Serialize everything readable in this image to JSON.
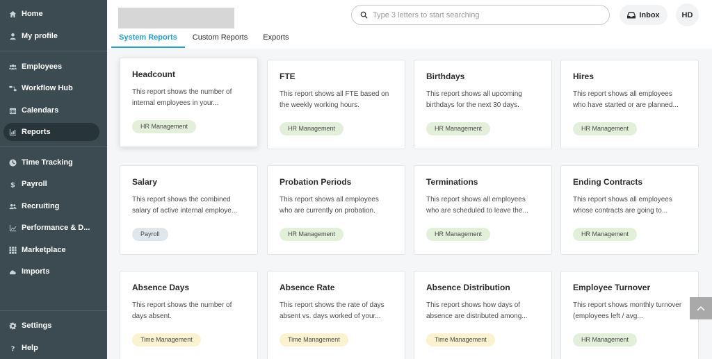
{
  "sidebar": {
    "items": [
      {
        "label": "Home",
        "icon": "home-icon",
        "active": false
      },
      {
        "label": "My profile",
        "icon": "user-icon",
        "active": false
      },
      {
        "label": "Employees",
        "icon": "users-icon",
        "active": false
      },
      {
        "label": "Workflow Hub",
        "icon": "workflow-icon",
        "active": false
      },
      {
        "label": "Calendars",
        "icon": "calendar-icon",
        "active": false
      },
      {
        "label": "Reports",
        "icon": "chart-icon",
        "active": true
      },
      {
        "label": "Time Tracking",
        "icon": "clock-icon",
        "active": false
      },
      {
        "label": "Payroll",
        "icon": "dollar-icon",
        "active": false
      },
      {
        "label": "Recruiting",
        "icon": "recruiting-icon",
        "active": false
      },
      {
        "label": "Performance & D...",
        "icon": "performance-icon",
        "active": false
      },
      {
        "label": "Marketplace",
        "icon": "grid-icon",
        "active": false
      },
      {
        "label": "Imports",
        "icon": "cloud-upload-icon",
        "active": false
      }
    ],
    "bottom_items": [
      {
        "label": "Settings",
        "icon": "gear-icon"
      },
      {
        "label": "Help",
        "icon": "question-icon"
      }
    ]
  },
  "header": {
    "search_placeholder": "Type 3 letters to start searching",
    "inbox_label": "Inbox",
    "avatar_initials": "HD"
  },
  "tabs": [
    {
      "label": "System Reports",
      "active": true
    },
    {
      "label": "Custom Reports",
      "active": false
    },
    {
      "label": "Exports",
      "active": false
    }
  ],
  "reports": [
    {
      "title": "Headcount",
      "description": "This report shows the number of internal employees in your...",
      "category": "HR Management",
      "category_type": "hr"
    },
    {
      "title": "FTE",
      "description": "This report shows all FTE based on the weekly working hours.",
      "category": "HR Management",
      "category_type": "hr"
    },
    {
      "title": "Birthdays",
      "description": "This report shows all upcoming birthdays for the next 30 days.",
      "category": "HR Management",
      "category_type": "hr"
    },
    {
      "title": "Hires",
      "description": "This report shows all employees who have started or are planned...",
      "category": "HR Management",
      "category_type": "hr"
    },
    {
      "title": "Salary",
      "description": "This report shows the combined salary of active internal employe...",
      "category": "Payroll",
      "category_type": "payroll"
    },
    {
      "title": "Probation Periods",
      "description": "This report shows all employees who are currently on probation.",
      "category": "HR Management",
      "category_type": "hr"
    },
    {
      "title": "Terminations",
      "description": "This report shows all employees who are scheduled to leave the...",
      "category": "HR Management",
      "category_type": "hr"
    },
    {
      "title": "Ending Contracts",
      "description": "This report shows all employees whose contracts are going to...",
      "category": "HR Management",
      "category_type": "hr"
    },
    {
      "title": "Absence Days",
      "description": "This report shows the number of days absent.",
      "category": "Time Management",
      "category_type": "time"
    },
    {
      "title": "Absence Rate",
      "description": "This report shows the rate of days absent vs. days worked of your...",
      "category": "Time Management",
      "category_type": "time"
    },
    {
      "title": "Absence Distribution",
      "description": "This report shows how days of absence are distributed among...",
      "category": "Time Management",
      "category_type": "time"
    },
    {
      "title": "Employee Turnover",
      "description": "This report shows monthly turnover (employees left / avg...",
      "category": "HR Management",
      "category_type": "hr"
    }
  ],
  "colors": {
    "sidebar_bg": "#3b4b51",
    "accent": "#1a9fd6",
    "badge_hr": "#e2efd9",
    "badge_payroll": "#dfe6ec",
    "badge_time": "#fbf3cf"
  }
}
